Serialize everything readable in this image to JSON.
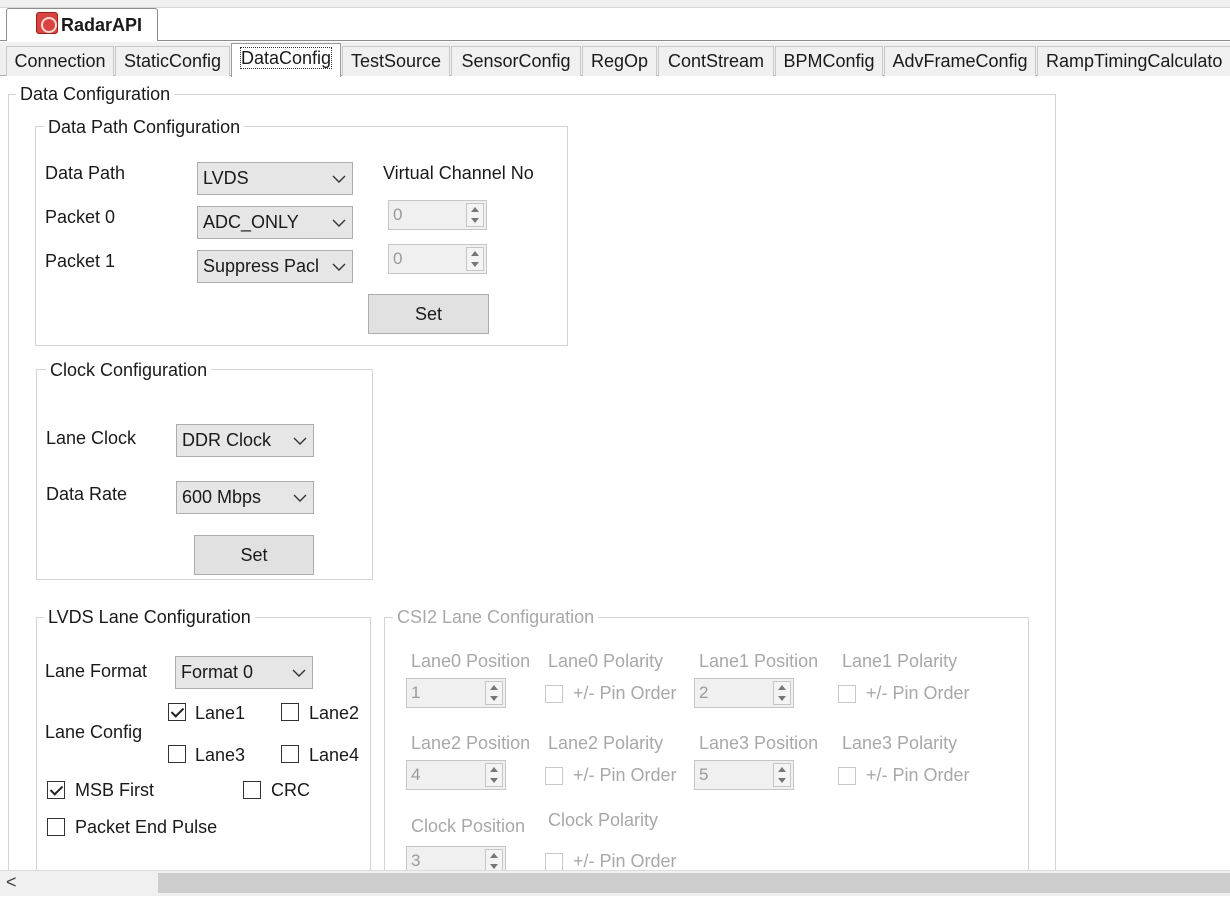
{
  "app": {
    "tab_title": "RadarAPI"
  },
  "tabs": [
    {
      "label": "Connection"
    },
    {
      "label": "StaticConfig"
    },
    {
      "label": "DataConfig"
    },
    {
      "label": "TestSource"
    },
    {
      "label": "SensorConfig"
    },
    {
      "label": "RegOp"
    },
    {
      "label": "ContStream"
    },
    {
      "label": "BPMConfig"
    },
    {
      "label": "AdvFrameConfig"
    },
    {
      "label": "RampTimingCalculato"
    }
  ],
  "data_configuration": {
    "title": "Data Configuration"
  },
  "data_path": {
    "title": "Data Path Configuration",
    "data_path_label": "Data Path",
    "data_path_value": "LVDS",
    "packet0_label": "Packet 0",
    "packet0_value": "ADC_ONLY",
    "packet1_label": "Packet 1",
    "packet1_value": "Suppress Pacl",
    "virtual_channel_label": "Virtual Channel No",
    "vc_packet0_value": "0",
    "vc_packet1_value": "0",
    "set_label": "Set"
  },
  "clock": {
    "title": "Clock Configuration",
    "lane_clock_label": "Lane Clock",
    "lane_clock_value": "DDR Clock",
    "data_rate_label": "Data Rate",
    "data_rate_value": "600 Mbps",
    "set_label": "Set"
  },
  "lvds": {
    "title": "LVDS Lane Configuration",
    "lane_format_label": "Lane Format",
    "lane_format_value": "Format 0",
    "lane_config_label": "Lane Config",
    "lane1_label": "Lane1",
    "lane1_checked": true,
    "lane2_label": "Lane2",
    "lane2_checked": false,
    "lane3_label": "Lane3",
    "lane3_checked": false,
    "lane4_label": "Lane4",
    "lane4_checked": false,
    "msb_first_label": "MSB First",
    "msb_first_checked": true,
    "crc_label": "CRC",
    "crc_checked": false,
    "packet_end_pulse_label": "Packet End Pulse",
    "packet_end_pulse_checked": false
  },
  "csi2": {
    "title": "CSI2 Lane Configuration",
    "lane0_position_label": "Lane0 Position",
    "lane0_position_value": "1",
    "lane0_polarity_label": "Lane0 Polarity",
    "lane1_position_label": "Lane1 Position",
    "lane1_position_value": "2",
    "lane1_polarity_label": "Lane1 Polarity",
    "lane2_position_label": "Lane2 Position",
    "lane2_position_value": "4",
    "lane2_polarity_label": "Lane2 Polarity",
    "lane3_position_label": "Lane3 Position",
    "lane3_position_value": "5",
    "lane3_polarity_label": "Lane3 Polarity",
    "clock_position_label": "Clock Position",
    "clock_position_value": "3",
    "clock_polarity_label": "Clock Polarity",
    "pin_order_label": "+/- Pin Order"
  },
  "scrollbar": {
    "left_arrow": "<"
  }
}
